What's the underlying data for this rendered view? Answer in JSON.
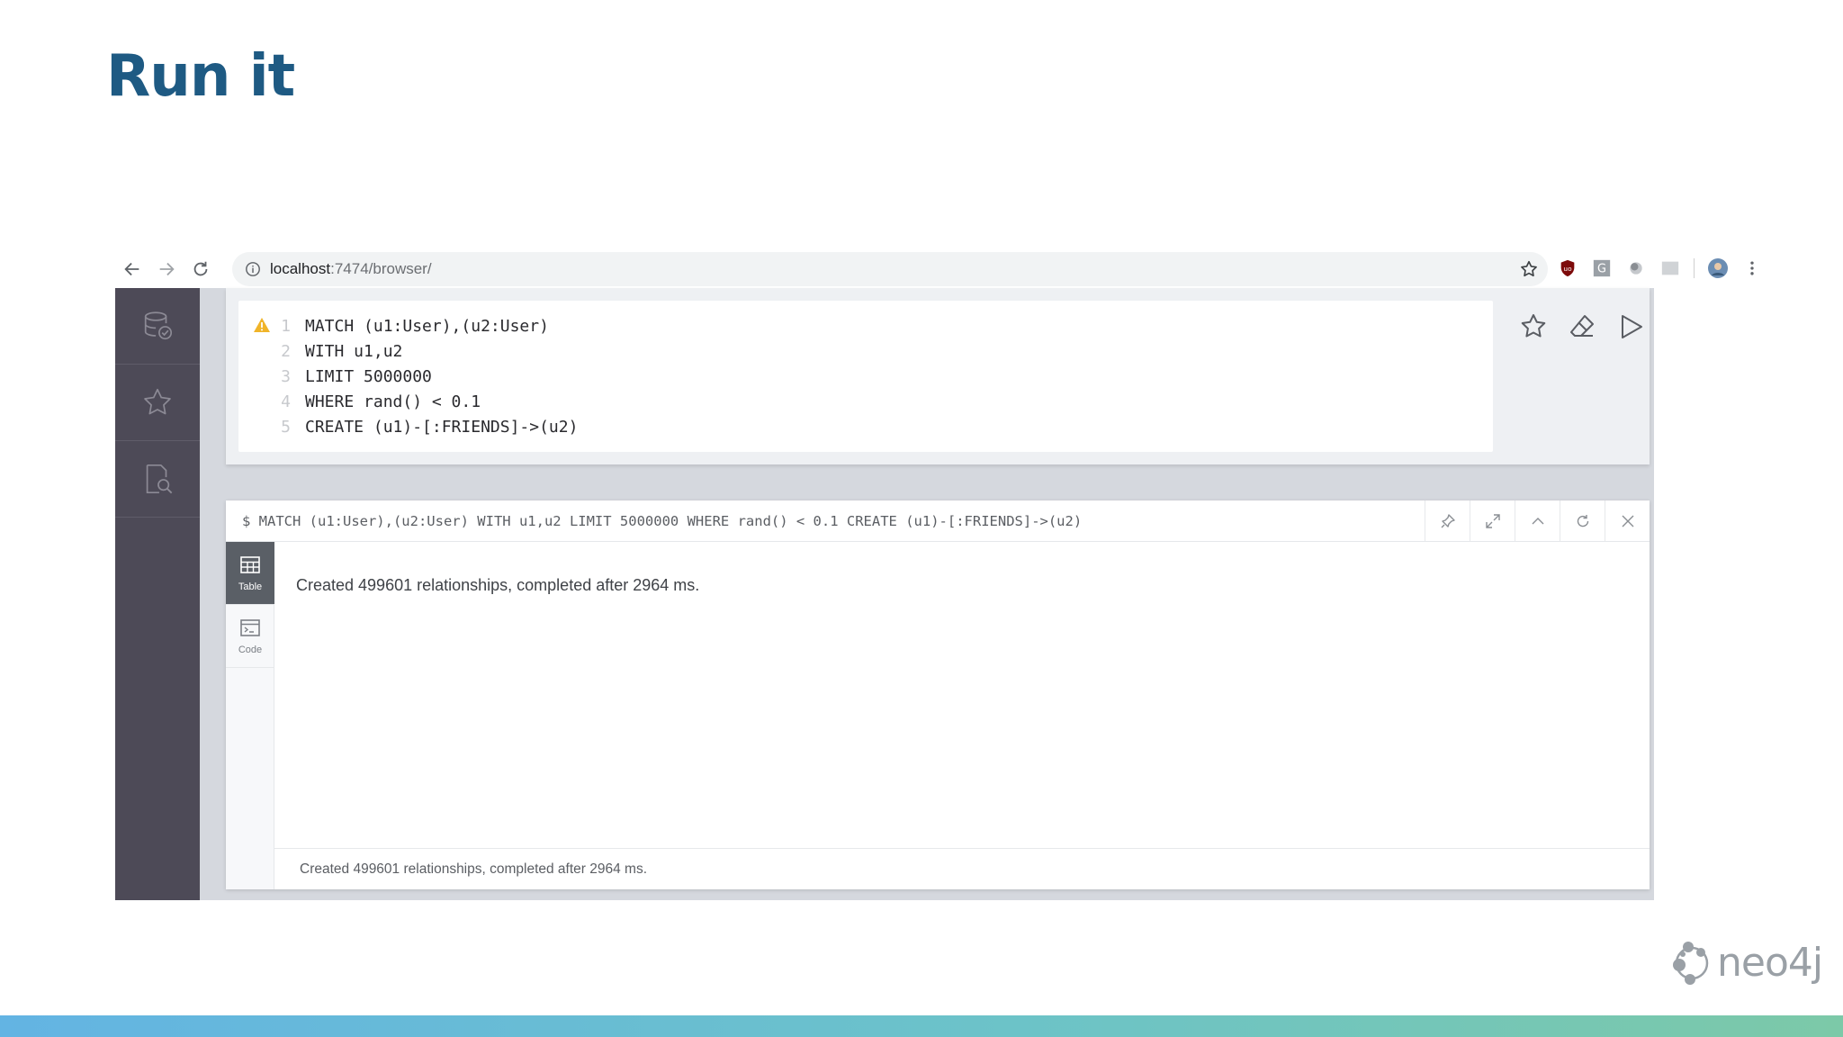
{
  "slide": {
    "title": "Run it"
  },
  "browser": {
    "url_host": "localhost",
    "url_path": ":7474/browser/"
  },
  "editor": {
    "lines": [
      {
        "num": "1",
        "code": "MATCH (u1:User),(u2:User)"
      },
      {
        "num": "2",
        "code": "WITH u1,u2"
      },
      {
        "num": "3",
        "code": "LIMIT 5000000"
      },
      {
        "num": "4",
        "code": "WHERE rand() < 0.1"
      },
      {
        "num": "5",
        "code": "CREATE (u1)-[:FRIENDS]->(u2)"
      }
    ]
  },
  "result": {
    "command": "$ MATCH (u1:User),(u2:User) WITH u1,u2 LIMIT 5000000 WHERE rand() < 0.1 CREATE (u1)-[:FRIENDS]->(u2)",
    "tabs": [
      {
        "label": "Table",
        "icon": "table-icon"
      },
      {
        "label": "Code",
        "icon": "code-icon"
      }
    ],
    "message": "Created 499601 relationships, completed after 2964 ms.",
    "footer": "Created 499601 relationships, completed after 2964 ms."
  },
  "logo": {
    "text": "neo4j"
  },
  "colors": {
    "title": "#1e5a83",
    "sidebar": "#4d4a57",
    "active_tab": "#5a5f66",
    "warning": "#f0b429"
  }
}
